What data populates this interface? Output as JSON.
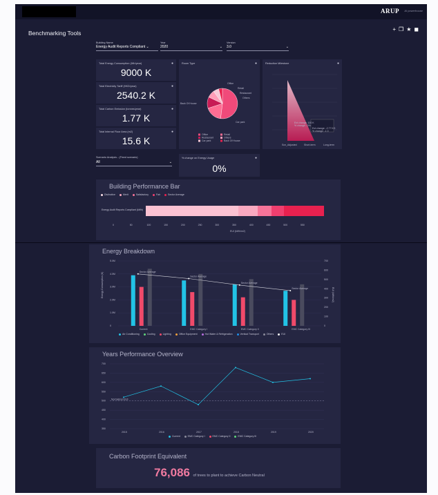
{
  "header": {
    "logo": "ARUP",
    "powered_by": "AI powerhouse"
  },
  "app": {
    "title": "Benchmarking Tools",
    "icons": [
      "plus-icon",
      "copy-icon",
      "star-icon",
      "tag-icon"
    ]
  },
  "filters": {
    "building_label": "Building Name",
    "building_value": "Energy Audit Reports Compliant",
    "year_label": "Year",
    "year_value": "2020",
    "version_label": "Version",
    "version_value": "3.0",
    "scenario_label": "Scenario Analysis - (Fixed scenario)",
    "scenario_value": "All"
  },
  "kpis": [
    {
      "title": "Total Energy Consumption (Wh/year)",
      "value": "9000 K"
    },
    {
      "title": "Total Electricity Tariff (HKD/year)",
      "value": "2540.2 K"
    },
    {
      "title": "Total Carbon Emission (tonnes/year)",
      "value": "1.77 K"
    },
    {
      "title": "Total Internal Floor Area (m2)",
      "value": "15.6 K"
    }
  ],
  "change": {
    "title": "% change on Energy Usage",
    "value": "0%"
  },
  "room_type": {
    "title": "Room Type",
    "legend": [
      "Office",
      "Retail",
      "Restaurant",
      "Others",
      "Car park",
      "Back Of House"
    ],
    "colors": [
      "#f04a7a",
      "#ff6d93",
      "#c81b55",
      "#ff9eb8",
      "#f7c9d6",
      "#e8214f"
    ],
    "shares": [
      0.52,
      0.18,
      0.12,
      0.08,
      0.06,
      0.04
    ]
  },
  "reduction": {
    "title": "Reduction Milestone",
    "categories": [
      "Scn_Adjusted",
      "Short-term",
      "Long-term"
    ],
    "annotations": [
      "Ext change: 100 K",
      "% change: -0%",
      "Ext change: -2.77 KG",
      "% change: -1.0"
    ]
  },
  "performance_bar": {
    "title": "Building Performance Bar",
    "legend": [
      "Distinctive",
      "Merit",
      "Satisfactory",
      "Fair",
      "Sector Average"
    ],
    "legend_colors": [
      "#fce0e8",
      "#f9a9c0",
      "#f67499",
      "#f03f6f",
      "#e8214f"
    ],
    "row_label": "Energy Audit Reports Compliant (kWh)",
    "ticks": [
      "0",
      "50",
      "100",
      "150",
      "200",
      "250",
      "300",
      "350",
      "400",
      "450",
      "500",
      "550"
    ],
    "xlabel": "EUI (kWh/m2)"
  },
  "energy_breakdown": {
    "title": "Energy Breakdown",
    "legend": [
      "Air Conditioning",
      "Cooling",
      "Lighting",
      "Office Equipment",
      "Hot Water & Refrigeration",
      "Vertical Transport",
      "Others",
      "EUI"
    ],
    "legend_colors": [
      "#22c3e6",
      "#5fd37a",
      "#f04a6a",
      "#f9a23c",
      "#b76ee0",
      "#1f8ee8",
      "#8a8a9a",
      "#f0f0f0"
    ],
    "ylabel": "Energy Consumption (K)",
    "y2label": "EUI (kWh/m2)"
  },
  "chart_data": {
    "type": "bar",
    "categories": [
      "Current",
      "EMC Category I",
      "EMC Category II",
      "EMC Category III"
    ],
    "series": [
      {
        "name": "Air Conditioning",
        "values": [
          3.9,
          3.5,
          3.2,
          2.7
        ]
      },
      {
        "name": "Lighting",
        "values": [
          3.0,
          2.6,
          2.2,
          2.0
        ]
      },
      {
        "name": "Others",
        "values": [
          4.4,
          4.0,
          3.6,
          3.2
        ]
      },
      {
        "name": "EUI",
        "values": [
          560,
          510,
          440,
          380
        ]
      }
    ],
    "annotations": [
      "Sector Average",
      "Sector Average",
      "Sector Average",
      "Sector Average"
    ],
    "y_ticks": [
      "0",
      "1.0M",
      "2.0M",
      "3.0M",
      "4.0M",
      "5.0M"
    ],
    "y2_ticks": [
      "0",
      "100",
      "200",
      "300",
      "400",
      "500",
      "600",
      "700"
    ],
    "ylim": [
      0,
      5
    ]
  },
  "years_overview": {
    "title": "Years Performance Overview",
    "x": [
      "2015",
      "2016",
      "2017",
      "2018",
      "2019",
      "2020"
    ],
    "current": [
      520,
      580,
      480,
      680,
      600,
      620
    ],
    "y_ticks": [
      "350",
      "400",
      "450",
      "500",
      "550",
      "600",
      "650",
      "700"
    ],
    "baseline_label": "Normalized EUI",
    "legend": [
      "Current",
      "EMC Category I",
      "EMC Category II",
      "EMC Category III"
    ],
    "legend_colors": [
      "#22c3e6",
      "#8a8a9a",
      "#f04a6a",
      "#5fd37a"
    ]
  },
  "carbon": {
    "title": "Carbon Footprint Equivalent",
    "value": "76,086",
    "suffix": "of trees to plant to achieve Carbon Neutral"
  }
}
